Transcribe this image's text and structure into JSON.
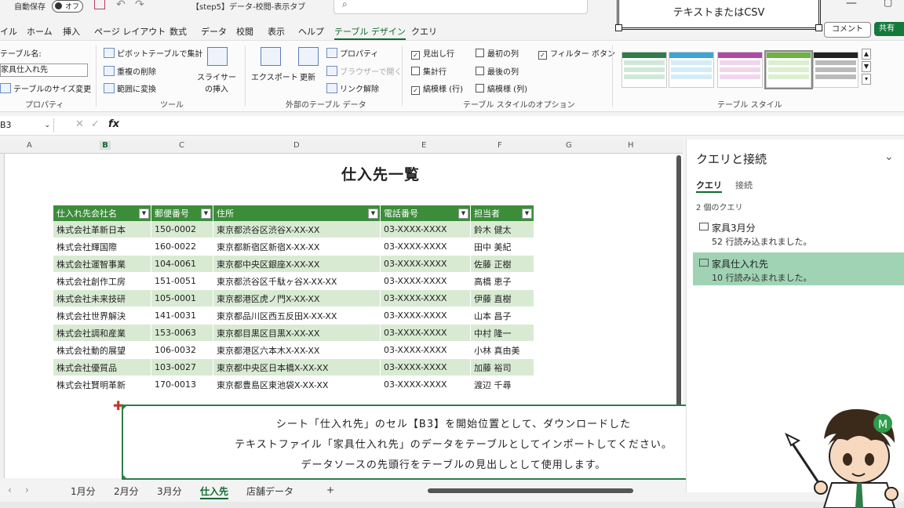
{
  "titlebar": {
    "autosave_label": "自動保存",
    "autosave_state": "オフ",
    "document_title": "【step5】データ-校閲-表示タブ",
    "banner": "テキストまたはCSV"
  },
  "menu": {
    "tabs": [
      "イル",
      "ホーム",
      "挿入",
      "ページ レイアウト",
      "数式",
      "データ",
      "校閲",
      "表示",
      "ヘルプ",
      "テーブル デザイン",
      "クエリ"
    ],
    "active": "テーブル デザイン",
    "comment_label": "コメント",
    "share_label": "共有"
  },
  "ribbon": {
    "table_name_label": "テーブル名:",
    "table_name_value": "家具仕入れ先",
    "resize_label": "テーブルのサイズ変更",
    "group_properties": "プロパティ",
    "pivot_label": "ピボットテーブルで集計",
    "dedupe_label": "重複の削除",
    "convert_label": "範囲に変換",
    "slicer_label": "スライサーの挿入",
    "group_tools": "ツール",
    "export_label": "エクスポート",
    "refresh_label": "更新",
    "props_label": "プロパティ",
    "browser_label": "ブラウザーで開く",
    "unlink_label": "リンク解除",
    "group_external": "外部のテーブル データ",
    "opt_header_row": "見出し行",
    "opt_total_row": "集計行",
    "opt_banded_rows": "縞模様 (行)",
    "opt_first_col": "最初の列",
    "opt_last_col": "最後の列",
    "opt_banded_cols": "縞模様 (列)",
    "opt_filter_btn": "フィルター ボタン",
    "group_style_options": "テーブル スタイルのオプション",
    "group_styles": "テーブル スタイル",
    "style_colors": [
      "#2e7d4a",
      "#3aa6d8",
      "#b04aa6",
      "#6cb33f",
      "#222222"
    ]
  },
  "formula_bar": {
    "name_box": "B3",
    "fx": "fx"
  },
  "grid": {
    "columns": [
      "A",
      "B",
      "C",
      "D",
      "E",
      "F",
      "G",
      "H"
    ],
    "selected_column": "B",
    "sheet_title": "仕入先一覧"
  },
  "table": {
    "headers": [
      "仕入れ先会社名",
      "郵便番号",
      "住所",
      "電話番号",
      "担当者"
    ],
    "rows": [
      [
        "株式会社革新日本",
        "150-0002",
        "東京都渋谷区渋谷X-XX-XX",
        "03-XXXX-XXXX",
        "鈴木 健太"
      ],
      [
        "株式会社輝国際",
        "160-0022",
        "東京都新宿区新宿X-XX-XX",
        "03-XXXX-XXXX",
        "田中 美紀"
      ],
      [
        "株式会社運智事業",
        "104-0061",
        "東京都中央区銀座X-XX-XX",
        "03-XXXX-XXXX",
        "佐藤 正樹"
      ],
      [
        "株式会社創作工房",
        "151-0051",
        "東京都渋谷区千駄ヶ谷X-XX-XX",
        "03-XXXX-XXXX",
        "高橋 恵子"
      ],
      [
        "株式会社未来技研",
        "105-0001",
        "東京都港区虎ノ門X-XX-XX",
        "03-XXXX-XXXX",
        "伊藤 直樹"
      ],
      [
        "株式会社世界解決",
        "141-0031",
        "東京都品川区西五反田X-XX-XX",
        "03-XXXX-XXXX",
        "山本 昌子"
      ],
      [
        "株式会社調和産業",
        "153-0063",
        "東京都目黒区目黒X-XX-XX",
        "03-XXXX-XXXX",
        "中村 隆一"
      ],
      [
        "株式会社動的展望",
        "106-0032",
        "東京都港区六本木X-XX-XX",
        "03-XXXX-XXXX",
        "小林 真由美"
      ],
      [
        "株式会社優質品",
        "103-0027",
        "東京都中央区日本橋X-XX-XX",
        "03-XXXX-XXXX",
        "加藤 裕司"
      ],
      [
        "株式会社賢明革新",
        "170-0013",
        "東京都豊島区東池袋X-XX-XX",
        "03-XXXX-XXXX",
        "渡辺 千尋"
      ]
    ]
  },
  "note": {
    "line1": "シート「仕入れ先」のセル【B3】を開始位置として、ダウンロードした",
    "line2": "テキストファイル「家具仕入れ先」のデータをテーブルとしてインポートしてください。",
    "line3": "データソースの先頭行をテーブルの見出しとして使用します。"
  },
  "sheet_tabs": {
    "tabs": [
      "1月分",
      "2月分",
      "3月分",
      "仕入先",
      "店舗データ"
    ],
    "active": "仕入先",
    "add": "+"
  },
  "query_pane": {
    "title": "クエリと接続",
    "tab_queries": "クエリ",
    "tab_connections": "接続",
    "count": "2 個のクエリ",
    "items": [
      {
        "name": "家具3月分",
        "status": "52 行読み込まれました。"
      },
      {
        "name": "家具仕入れ先",
        "status": "10 行読み込まれました。"
      }
    ]
  },
  "colors": {
    "accent": "#106b2f",
    "table_header": "#3c8d3a",
    "band": "#d9ead3",
    "selected_query": "#9fd3b4"
  }
}
